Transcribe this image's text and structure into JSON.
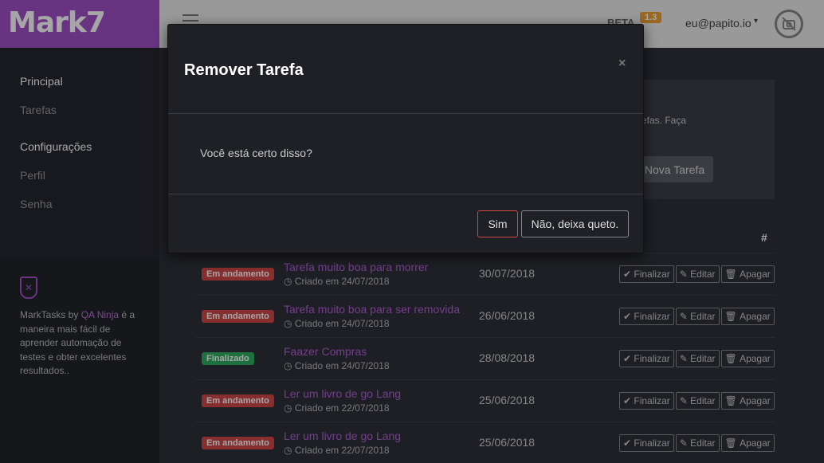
{
  "header": {
    "logo": "Mark7",
    "beta_label": "BETA",
    "beta_version": "1.3",
    "user_email": "eu@papito.io",
    "user_caret": "▾"
  },
  "sidebar": {
    "sections": [
      {
        "title": "Principal",
        "items": [
          "Tarefas"
        ]
      },
      {
        "title": "Configurações",
        "items": [
          "Perfil",
          "Senha"
        ]
      }
    ],
    "footer": {
      "prefix": "MarkTasks by ",
      "link": "QA Ninja",
      "suffix": " é a maneira mais fácil de aprender automação de testes e obter excelentes resultados.."
    }
  },
  "main": {
    "info_text": "efas. Faça",
    "new_task_button": "Nova Tarefa",
    "actions_header": "#",
    "rows": [
      {
        "status": "Em andamento",
        "status_type": "doing",
        "title": "Tarefa muito boa para morrer",
        "created": "Criado em 24/07/2018",
        "date": "30/07/2018"
      },
      {
        "status": "Em andamento",
        "status_type": "doing",
        "title": "Tarefa muito boa para ser removida",
        "created": "Criado em 24/07/2018",
        "date": "26/06/2018"
      },
      {
        "status": "Finalizado",
        "status_type": "done",
        "title": "Faazer Compras",
        "created": "Criado em 24/07/2018",
        "date": "28/08/2018"
      },
      {
        "status": "Em andamento",
        "status_type": "doing",
        "title": "Ler um livro de go Lang",
        "created": "Criado em 22/07/2018",
        "date": "25/06/2018"
      },
      {
        "status": "Em andamento",
        "status_type": "doing",
        "title": "Ler um livro de go Lang",
        "created": "Criado em 22/07/2018",
        "date": "25/06/2018"
      }
    ],
    "row_actions": {
      "finish": "Finalizar",
      "edit": "Editar",
      "delete": "Apagar"
    }
  },
  "modal": {
    "title": "Remover Tarefa",
    "close": "×",
    "body": "Você está certo disso?",
    "confirm": "Sim",
    "cancel": "Não, deixa queto."
  },
  "colors": {
    "brand": "#a050c8",
    "status_doing": "#d04848",
    "status_done": "#2fae62",
    "beta_badge": "#f0a030"
  }
}
